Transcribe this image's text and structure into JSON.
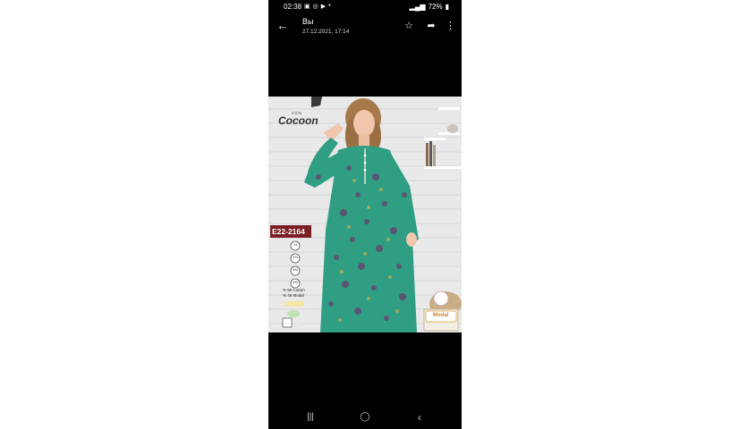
{
  "status_bar": {
    "time": "02:38",
    "battery": "72%"
  },
  "header": {
    "title": "Вы",
    "subtitle": "27.12.2021, 17:14"
  },
  "photo": {
    "brand_small": "CCN",
    "brand": "Cocoon",
    "model_code": "E22-2164",
    "sizes": [
      "XL",
      "2XL",
      "3XL",
      "4XL"
    ],
    "composition": [
      "% 55 Cotton",
      "% 45 Modal"
    ],
    "badge": "Modal"
  },
  "colors": {
    "bar_background": "#000000",
    "dress": "#2f9e83",
    "badge": "#7a1f24"
  }
}
